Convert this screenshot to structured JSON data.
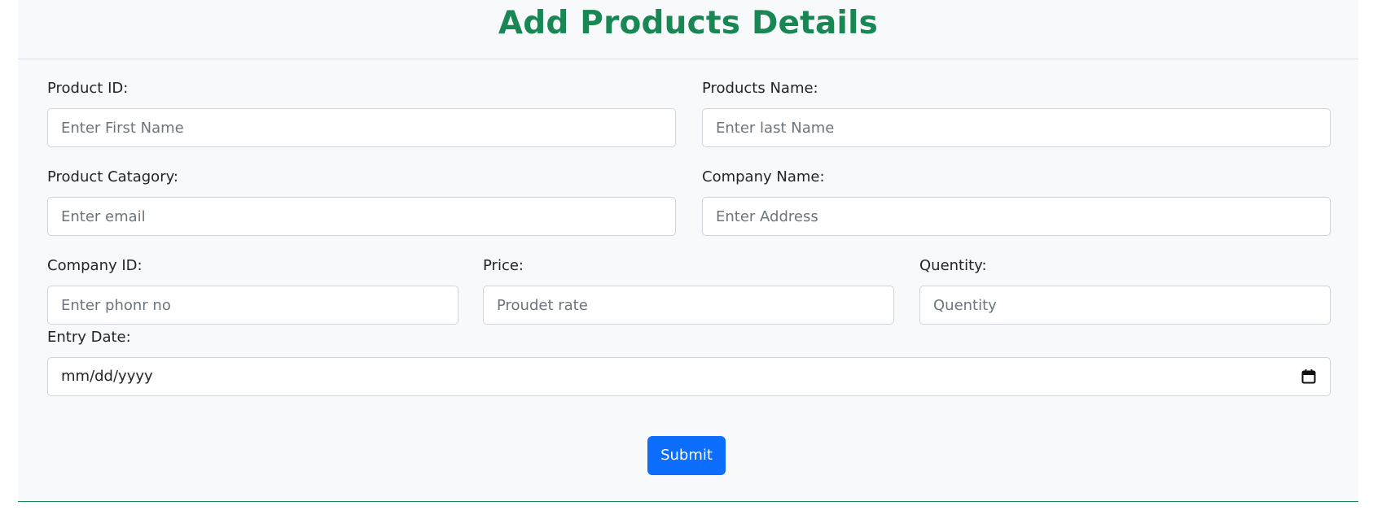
{
  "header": {
    "title": "Add Products Details"
  },
  "form": {
    "product_id": {
      "label": "Product ID:",
      "placeholder": "Enter First Name",
      "value": ""
    },
    "product_name": {
      "label": "Products Name:",
      "placeholder": "Enter last Name",
      "value": ""
    },
    "product_category": {
      "label": "Product Catagory:",
      "placeholder": "Enter email",
      "value": ""
    },
    "company_name": {
      "label": "Company Name:",
      "placeholder": "Enter Address",
      "value": ""
    },
    "company_id": {
      "label": "Company ID:",
      "placeholder": "Enter phonr no",
      "value": ""
    },
    "price": {
      "label": "Price:",
      "placeholder": "Proudet rate",
      "value": ""
    },
    "quantity": {
      "label": "Quentity:",
      "placeholder": "Quentity",
      "value": ""
    },
    "entry_date": {
      "label": "Entry Date:",
      "display": "mm/dd/yyyy",
      "icon": "calendar-icon"
    },
    "submit_label": "Submit"
  },
  "colors": {
    "title": "#198754",
    "primary_button": "#0d6efd",
    "card_background": "#f8f9fa",
    "bottom_border": "#198754"
  }
}
